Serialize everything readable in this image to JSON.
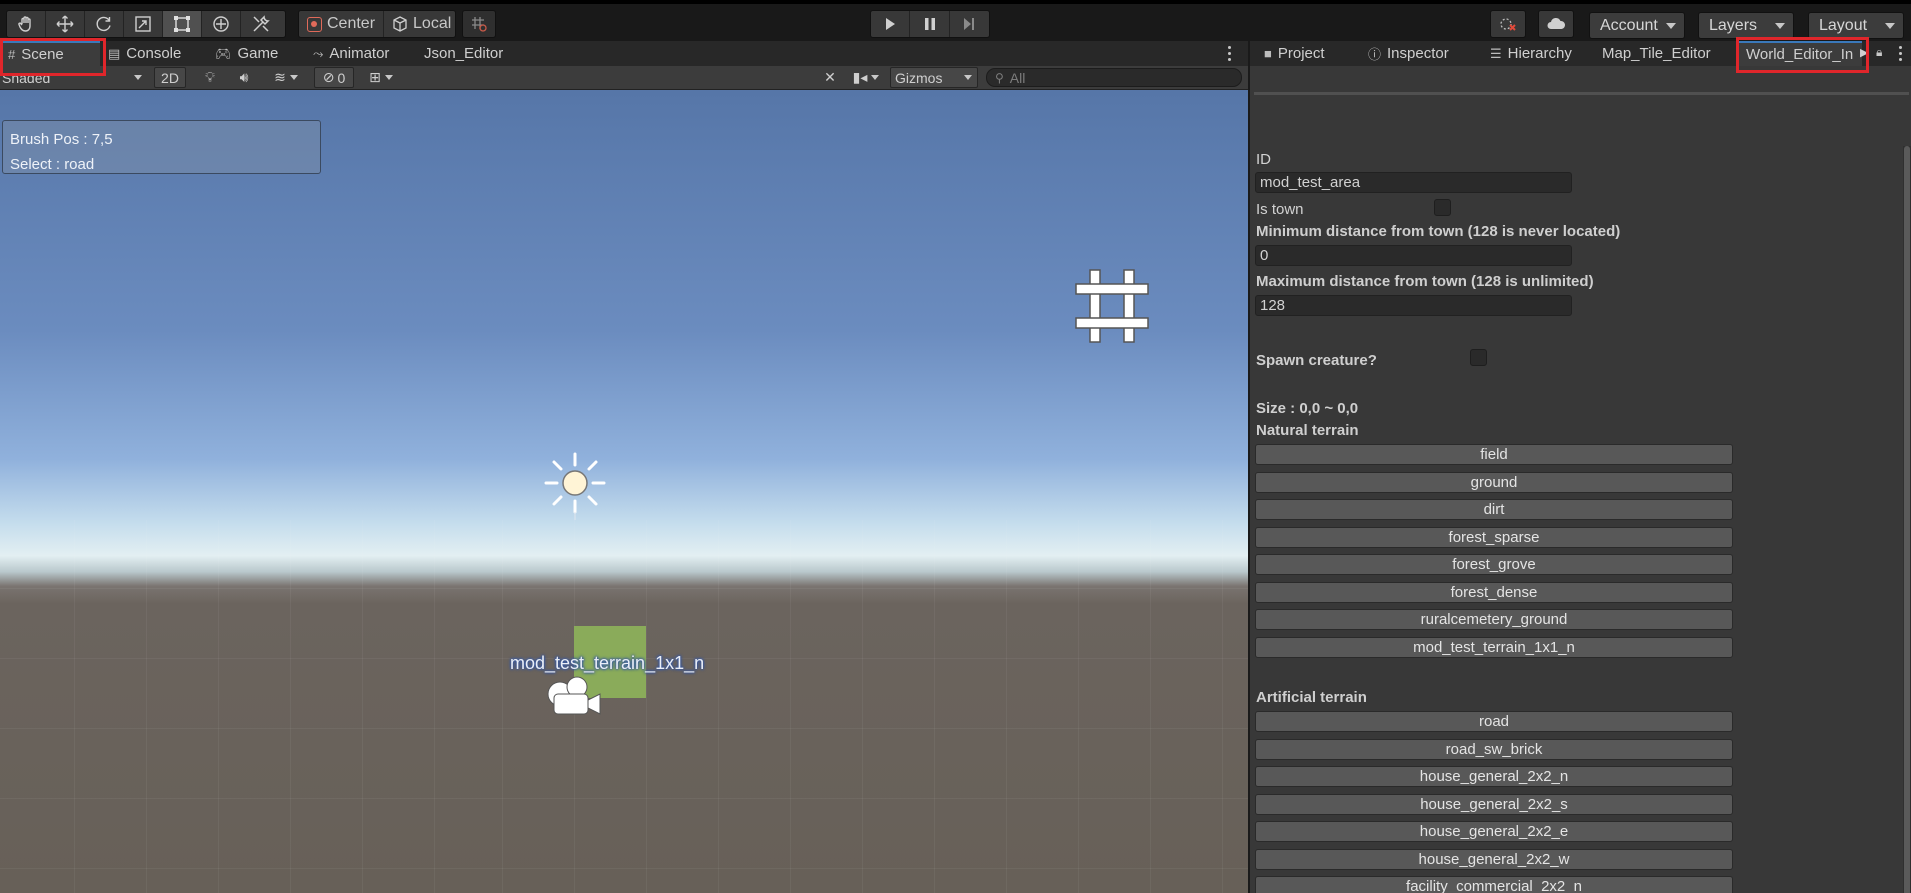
{
  "toolbar": {
    "tools": [
      "hand-icon",
      "move-icon",
      "rotate-icon",
      "scale-icon",
      "rect-tool-icon",
      "transform-icon",
      "custom-tool-icon"
    ],
    "pivot_label": "Center",
    "space_label": "Local",
    "account_label": "Account",
    "layers_label": "Layers",
    "layout_label": "Layout"
  },
  "scene_tabs": [
    {
      "label": "Scene",
      "icon": "grid-icon"
    },
    {
      "label": "Console",
      "icon": "console-icon"
    },
    {
      "label": "Game",
      "icon": "gamepad-icon"
    },
    {
      "label": "Animator",
      "icon": "animator-icon"
    },
    {
      "label": "Json_Editor",
      "icon": ""
    }
  ],
  "scene_toolbar": {
    "shading": "Shaded",
    "mode_2d": "2D",
    "hidden_count": "0",
    "gizmos": "Gizmos",
    "search_placeholder": "All"
  },
  "scene_overlay": {
    "brush_pos": "Brush Pos : 7,5",
    "select": "Select : road"
  },
  "scene_objects": {
    "tile_label": "mod_test_terrain_1x1_n"
  },
  "right_tabs": [
    {
      "label": "Project",
      "icon": "folder-icon"
    },
    {
      "label": "Inspector",
      "icon": "info-icon"
    },
    {
      "label": "Hierarchy",
      "icon": "hierarchy-icon"
    },
    {
      "label": "Map_Tile_Editor",
      "icon": ""
    },
    {
      "label": "World_Editor_In",
      "icon": ""
    }
  ],
  "editor": {
    "id_label": "ID",
    "id_value": "mod_test_area",
    "is_town_label": "Is town",
    "is_town": false,
    "min_dist_label": "Minimum distance from town (128 is never located)",
    "min_dist_value": "0",
    "max_dist_label": "Maximum distance from town (128 is unlimited)",
    "max_dist_value": "128",
    "spawn_label": "Spawn creature?",
    "spawn": false,
    "size_label": "Size : 0,0 ~ 0,0",
    "natural_label": "Natural terrain",
    "natural_terrain": [
      "field",
      "ground",
      "dirt",
      "forest_sparse",
      "forest_grove",
      "forest_dense",
      "ruralcemetery_ground",
      "mod_test_terrain_1x1_n"
    ],
    "artificial_label": "Artificial terrain",
    "artificial_terrain": [
      "road",
      "road_sw_brick",
      "house_general_2x2_n",
      "house_general_2x2_s",
      "house_general_2x2_e",
      "house_general_2x2_w",
      "facility_commercial_2x2_n"
    ]
  },
  "colors": {
    "highlight": "#e0262b",
    "accent": "#3a79bb"
  }
}
